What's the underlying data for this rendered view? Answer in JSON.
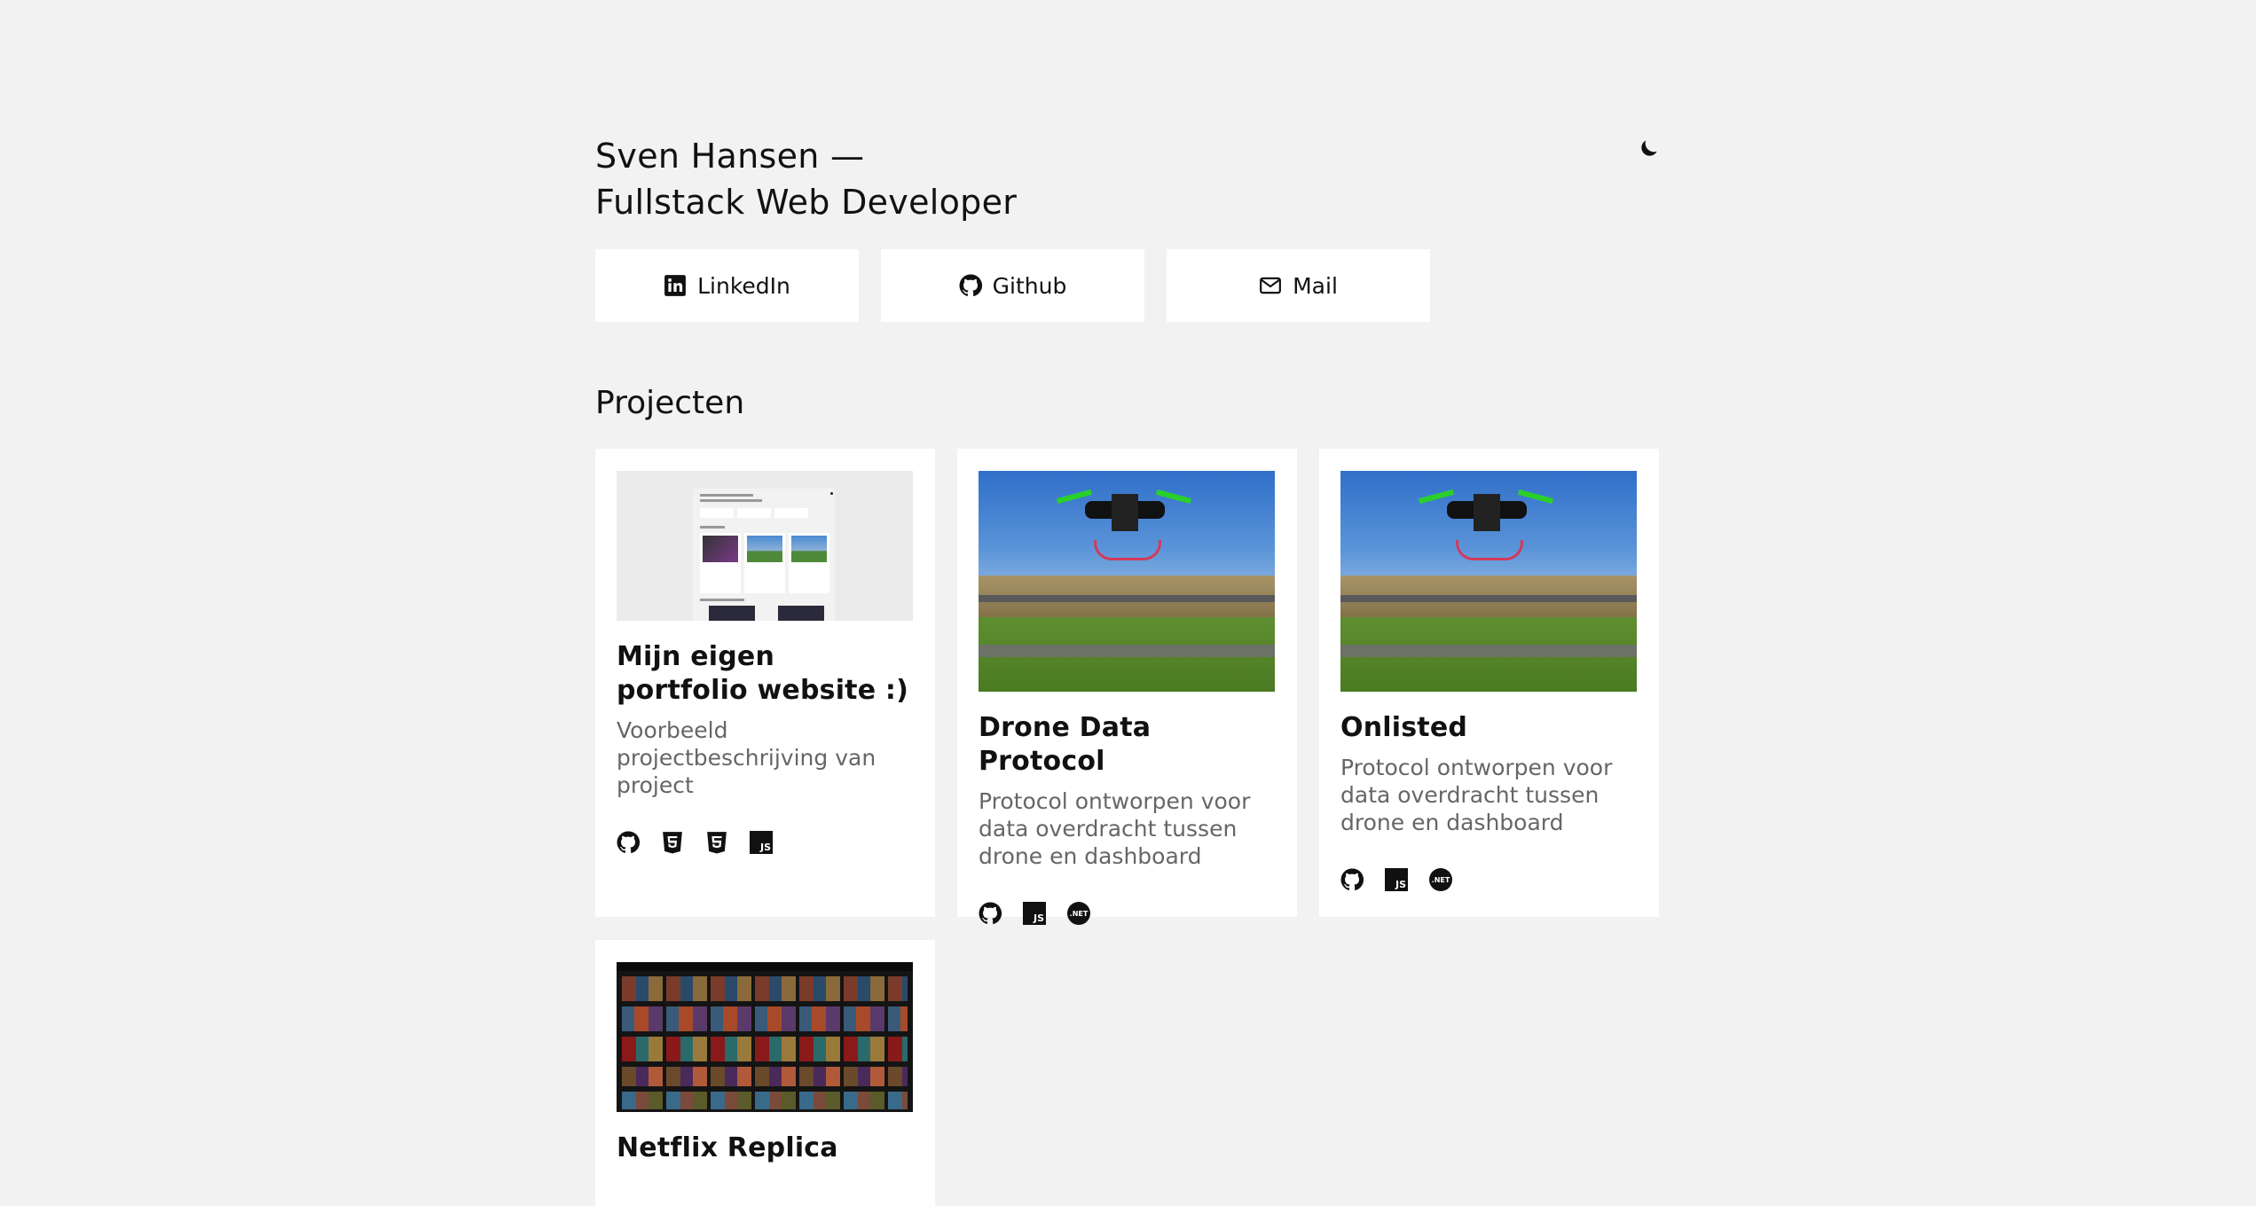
{
  "header": {
    "title_line1": "Sven Hansen —",
    "title_line2": "Fullstack Web Developer",
    "theme_toggle_icon": "moon-icon"
  },
  "links": [
    {
      "label": "LinkedIn",
      "icon": "linkedin-icon"
    },
    {
      "label": "Github",
      "icon": "github-icon"
    },
    {
      "label": "Mail",
      "icon": "mail-icon"
    }
  ],
  "projects": {
    "title": "Projecten",
    "items": [
      {
        "title": "Mijn eigen portfolio website :)",
        "description": "Voorbeeld projectbeschrijving van project",
        "thumbnail": "portfolio-screenshot",
        "tech": [
          "github-icon",
          "html5-icon",
          "css3-icon",
          "javascript-icon"
        ]
      },
      {
        "title": "Drone Data Protocol",
        "description": "Protocol ontworpen voor data overdracht tussen drone en dashboard",
        "thumbnail": "drone-photo",
        "tech": [
          "github-icon",
          "javascript-icon",
          "dotnet-icon"
        ]
      },
      {
        "title": "Onlisted",
        "description": "Protocol ontworpen voor data overdracht tussen drone en dashboard",
        "thumbnail": "drone-photo",
        "tech": [
          "github-icon",
          "javascript-icon",
          "dotnet-icon"
        ]
      },
      {
        "title": "Netflix Replica",
        "description": "",
        "thumbnail": "netflix-screenshot",
        "tech": []
      }
    ]
  },
  "badges": {
    "js": "JS",
    "net": ".NET"
  },
  "colors": {
    "background": "#f2f2f2",
    "card": "#ffffff",
    "text": "#111111",
    "muted": "#666666"
  }
}
